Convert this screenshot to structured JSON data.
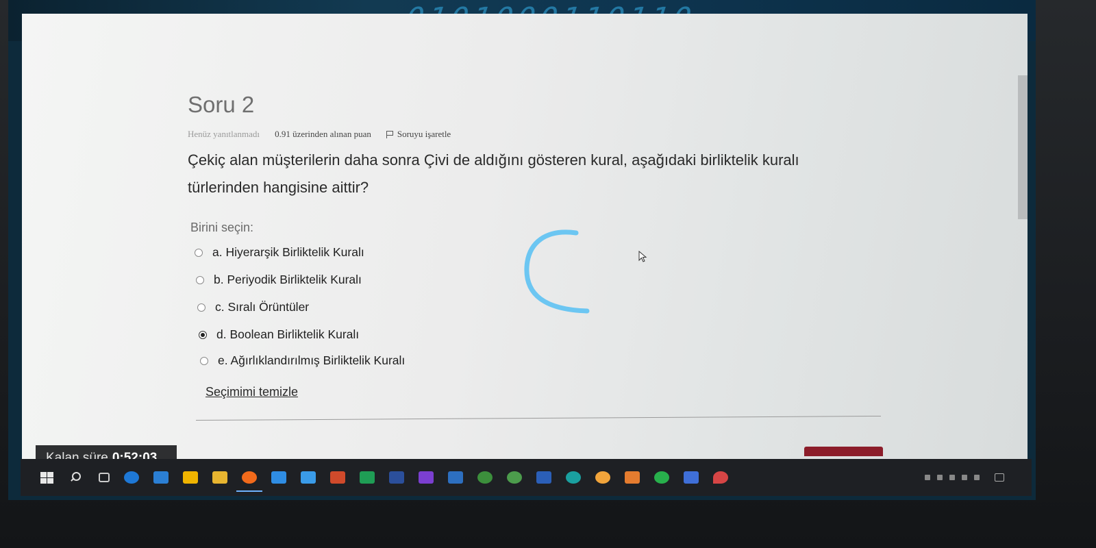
{
  "question": {
    "title": "Soru 2",
    "state": "Henüz yanıtlanmadı",
    "marks": "0.91 üzerinden alınan puan",
    "flag_label": "Soruyu işaretle",
    "text_line1": "Çekiç alan müşterilerin daha sonra Çivi de aldığını gösteren kural, aşağıdaki birliktelik kuralı",
    "text_line2": "türlerinden hangisine aittir?",
    "prompt": "Birini seçin:",
    "options": [
      {
        "label": "a. Hiyerarşik Birliktelik Kuralı",
        "checked": false
      },
      {
        "label": "b. Periyodik Birliktelik Kuralı",
        "checked": false
      },
      {
        "label": "c. Sıralı Örüntüler",
        "checked": false
      },
      {
        "label": "d. Boolean Birliktelik Kuralı",
        "checked": true
      },
      {
        "label": "e. Ağırlıklandırılmış Birliktelik Kuralı",
        "checked": false
      }
    ],
    "clear_label": "Seçimimi temizle"
  },
  "timer": {
    "label": "Kalan süre",
    "value": "0:52:03"
  },
  "colors": {
    "accent_button": "#8c1d2a",
    "scribble": "#6cc6f2"
  },
  "taskbar": {
    "icons": [
      "windows-start-icon",
      "search-icon",
      "task-view-icon",
      "edge-icon",
      "mail-icon",
      "store-icon",
      "file-explorer-icon",
      "firefox-icon",
      "app-icon",
      "mail-app-icon",
      "powerpoint-icon",
      "excel-icon",
      "visio-icon",
      "visual-studio-icon",
      "yammer-icon",
      "app-icon-2",
      "app-icon-3",
      "word-icon",
      "app-icon-4",
      "music-icon",
      "app-icon-5",
      "whatsapp-icon",
      "app-icon-6",
      "app-icon-7"
    ]
  }
}
